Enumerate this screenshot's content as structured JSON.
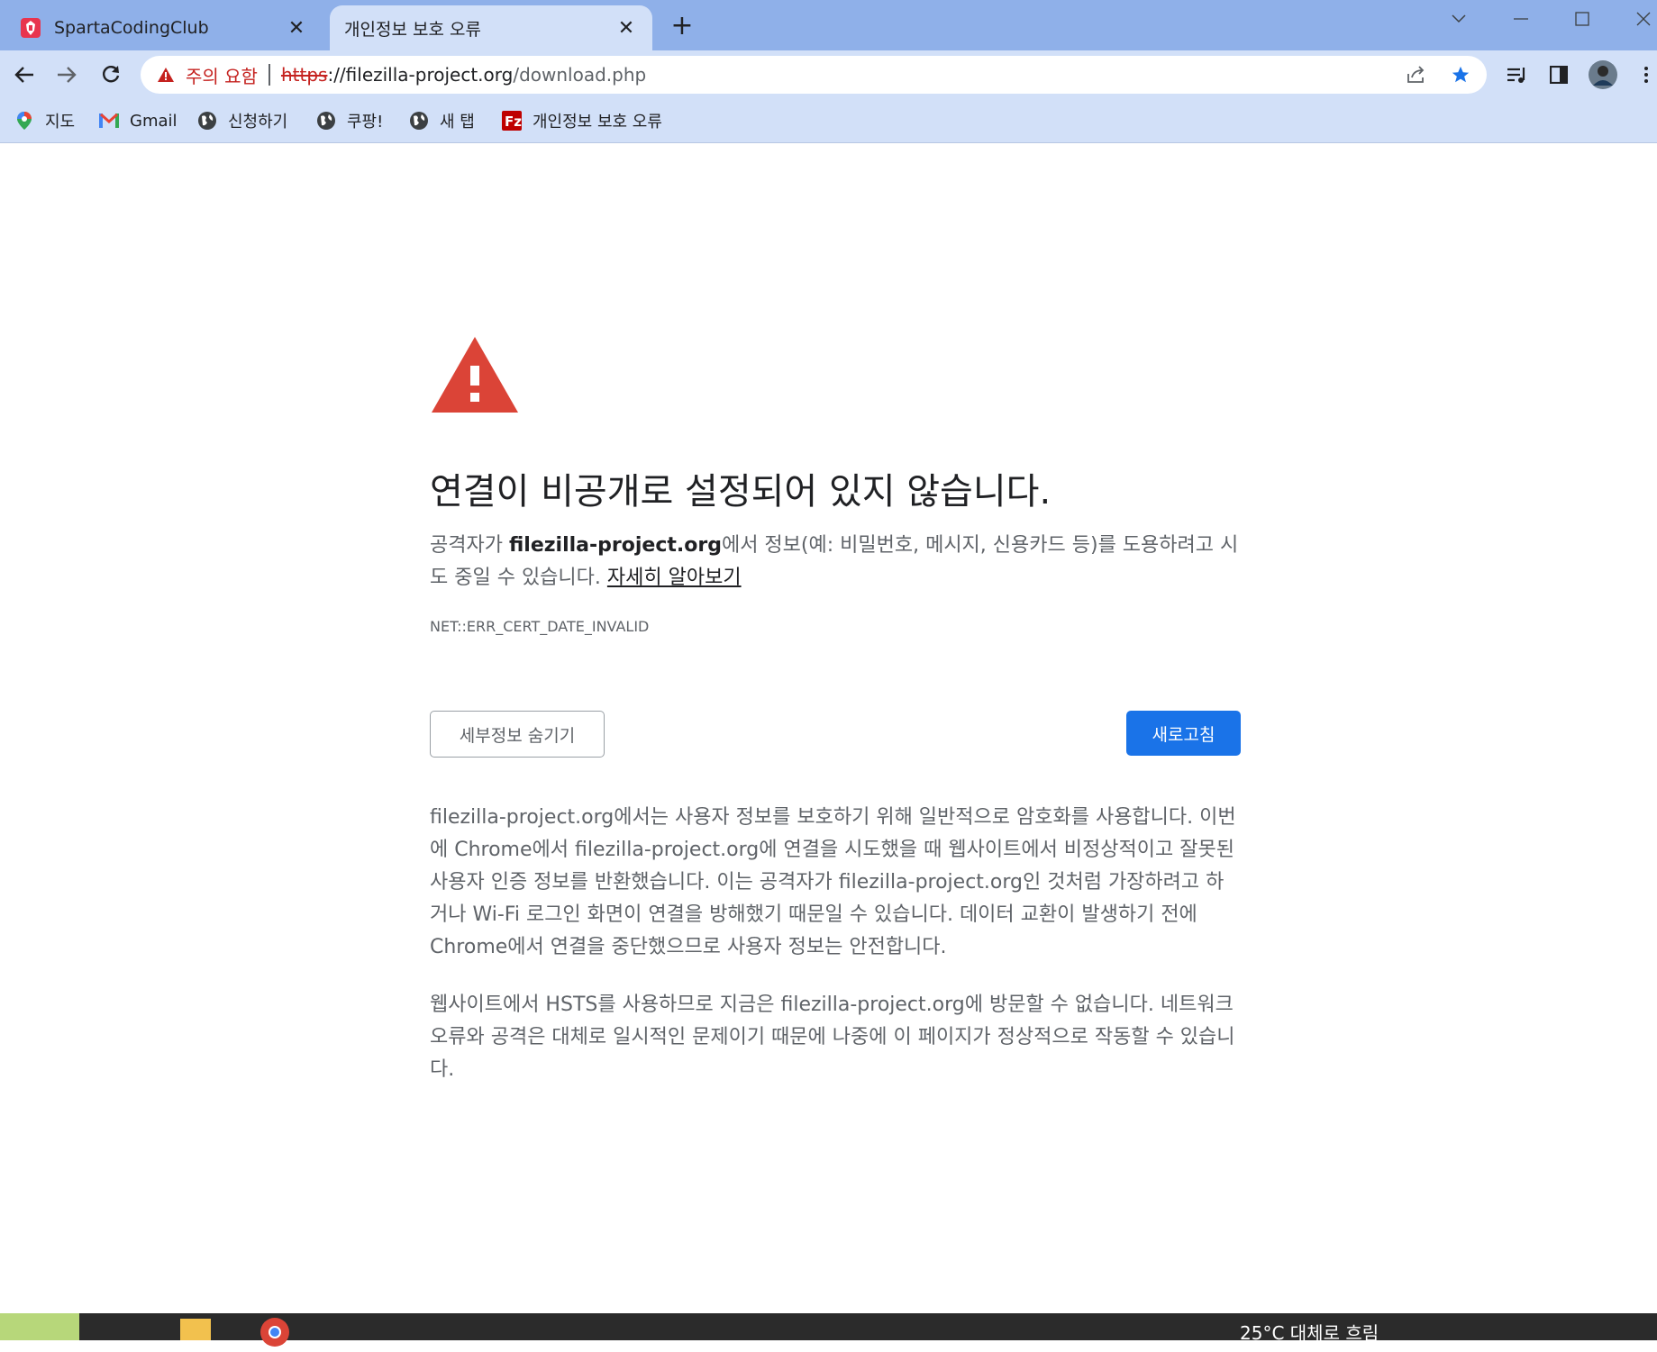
{
  "colors": {
    "tabstrip_bg": "#8fb0e9",
    "toolbar_bg": "#d2e0f8",
    "warning_red": "#c5221f",
    "triangle_red": "#db4437",
    "primary_blue": "#1a73e8"
  },
  "tabs": [
    {
      "title": "SpartaCodingClub",
      "icon": "sparta-favicon-icon"
    },
    {
      "title": "개인정보 보호 오류",
      "icon": ""
    }
  ],
  "omnibox": {
    "security_label": "주의 요함",
    "scheme": "https",
    "host": "://filezilla-project.org",
    "path": "/download.php"
  },
  "bookmarks": [
    {
      "label": "지도",
      "icon": "maps-pin-icon"
    },
    {
      "label": "Gmail",
      "icon": "gmail-icon"
    },
    {
      "label": "신청하기",
      "icon": "globe-icon"
    },
    {
      "label": "쿠팡!",
      "icon": "globe-icon"
    },
    {
      "label": "새 탭",
      "icon": "globe-icon"
    },
    {
      "label": "개인정보 보호 오류",
      "icon": "filezilla-icon"
    }
  ],
  "interstitial": {
    "heading": "연결이 비공개로 설정되어 있지 않습니다.",
    "desc_before": "공격자가 ",
    "desc_host": "filezilla-project.org",
    "desc_after": "에서 정보(예: 비밀번호, 메시지, 신용카드 등)를 도용하려고 시도 중일 수 있습니다. ",
    "learn_more": "자세히 알아보기",
    "error_code": "NET::ERR_CERT_DATE_INVALID",
    "details_button": "세부정보 숨기기",
    "reload_button": "새로고침",
    "details_paragraph_1": "filezilla-project.org에서는 사용자 정보를 보호하기 위해 일반적으로 암호화를 사용합니다. 이번에 Chrome에서 filezilla-project.org에 연결을 시도했을 때 웹사이트에서 비정상적이고 잘못된 사용자 인증 정보를 반환했습니다. 이는 공격자가 filezilla-project.org인 것처럼 가장하려고 하거나 Wi-Fi 로그인 화면이 연결을 방해했기 때문일 수 있습니다. 데이터 교환이 발생하기 전에 Chrome에서 연결을 중단했으므로 사용자 정보는 안전합니다.",
    "details_paragraph_2": "웹사이트에서 HSTS를 사용하므로 지금은 filezilla-project.org에 방문할 수 없습니다. 네트워크 오류와 공격은 대체로 일시적인 문제이기 때문에 나중에 이 페이지가 정상적으로 작동할 수 있습니다."
  },
  "taskbar": {
    "weather": "25°C 대체로 흐림"
  }
}
